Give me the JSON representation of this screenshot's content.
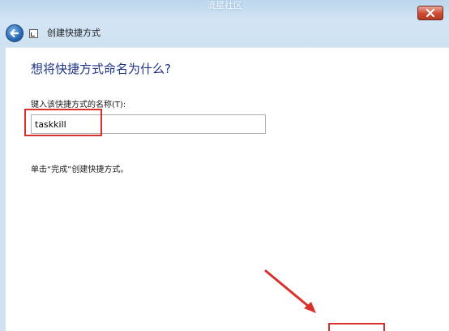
{
  "watermark": {
    "text": "流星社区"
  },
  "titlebar": {
    "close_icon": "close-icon"
  },
  "header": {
    "back_icon": "back-arrow-icon",
    "wizard_icon": "shortcut-wizard-icon",
    "title": "创建快捷方式"
  },
  "content": {
    "heading": "想将快捷方式命名为什么?",
    "field_label": "键入该快捷方式的名称(T):",
    "name_value": "taskkill",
    "instruction": "单击“完成”创建快捷方式。"
  },
  "colors": {
    "annotation": "#d9302c",
    "heading": "#1e3287"
  }
}
